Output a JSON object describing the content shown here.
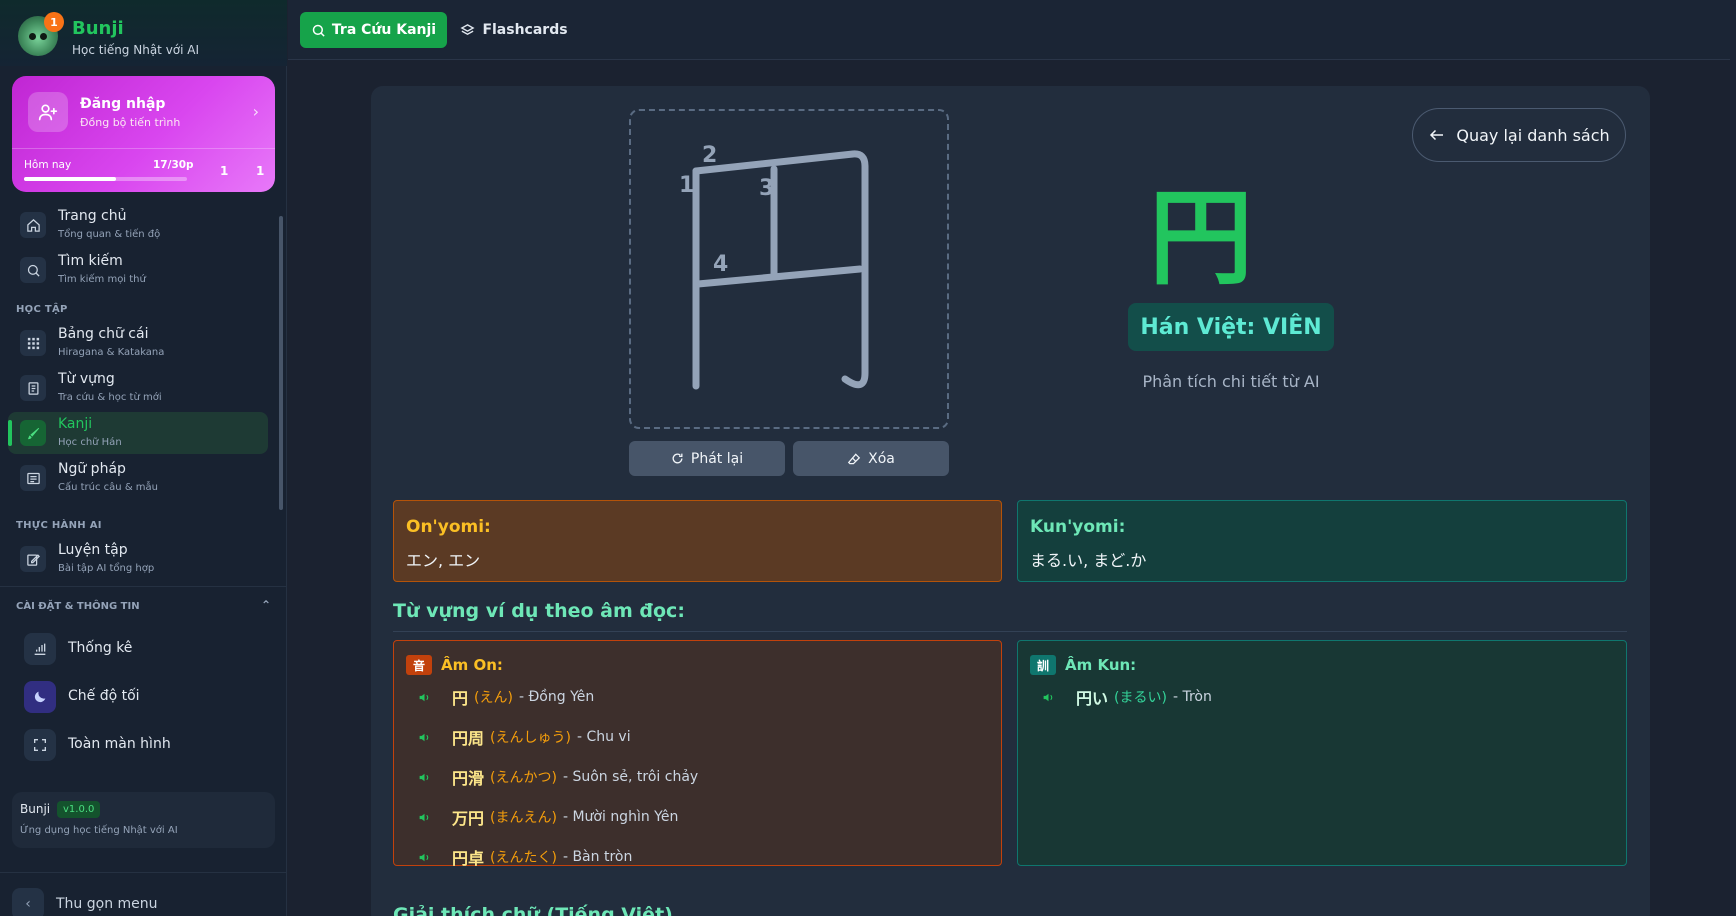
{
  "brand": {
    "name": "Bunji",
    "subtitle": "Học tiếng Nhật với AI",
    "badge": "1"
  },
  "login": {
    "title": "Đăng nhập",
    "subtitle": "Đồng bộ tiến trình",
    "today_label": "Hôm nay",
    "today_value": "17/30p",
    "progress_fraction": 0.567,
    "stat1": "1",
    "stat2": "1"
  },
  "nav": {
    "items": [
      {
        "title": "Trang chủ",
        "sub": "Tổng quan & tiến độ",
        "icon": "home-icon"
      },
      {
        "title": "Tìm kiếm",
        "sub": "Tìm kiếm mọi thứ",
        "icon": "search-icon"
      },
      {
        "title": "Bảng chữ cái",
        "sub": "Hiragana & Katakana",
        "icon": "grid-icon"
      },
      {
        "title": "Từ vựng",
        "sub": "Tra cứu & học từ mới",
        "icon": "book-icon"
      },
      {
        "title": "Kanji",
        "sub": "Học chữ Hán",
        "icon": "brush-icon",
        "active": true
      },
      {
        "title": "Ngữ pháp",
        "sub": "Cấu trúc câu & mẫu",
        "icon": "list-icon"
      },
      {
        "title": "Luyện tập",
        "sub": "Bài tập AI tổng hợp",
        "icon": "edit-icon"
      }
    ],
    "section_learning": "HỌC TẬP",
    "section_ai": "THỰC HÀNH AI"
  },
  "settings": {
    "heading": "CÀI ĐẶT & THÔNG TIN",
    "items": [
      {
        "label": "Thống kê",
        "icon": "chart-icon"
      },
      {
        "label": "Chế độ tối",
        "icon": "moon-icon"
      },
      {
        "label": "Toàn màn hình",
        "icon": "fullscreen-icon"
      }
    ]
  },
  "version": {
    "name": "Bunji",
    "badge": "v1.0.0",
    "subtitle": "Ứng dụng học tiếng Nhật với AI"
  },
  "collapse_label": "Thu gọn menu",
  "topbar": {
    "primary_tab": "Tra Cứu Kanji",
    "secondary_tab": "Flashcards"
  },
  "kanji": {
    "character": "円",
    "han_viet": "Hán Việt: VIÊN",
    "analysis": "Phân tích chi tiết từ AI",
    "stroke_numbers": [
      "1",
      "2",
      "3",
      "4"
    ],
    "replay_label": "Phát lại",
    "clear_label": "Xóa",
    "back_label": "Quay lại danh sách"
  },
  "readings": {
    "on_title": "On'yomi:",
    "on_value": "エン, エン",
    "kun_title": "Kun'yomi:",
    "kun_value": "まる.い, まど.か"
  },
  "examples": {
    "heading": "Từ vựng ví dụ theo âm đọc:",
    "on_badge": "音",
    "on_title": "Âm On:",
    "on_items": [
      {
        "word": "円",
        "reading": "(えん)",
        "meaning": "- Đồng Yên"
      },
      {
        "word": "円周",
        "reading": "(えんしゅう)",
        "meaning": "- Chu vi"
      },
      {
        "word": "円滑",
        "reading": "(えんかつ)",
        "meaning": "- Suôn sẻ, trôi chảy"
      },
      {
        "word": "万円",
        "reading": "(まんえん)",
        "meaning": "- Mười nghìn Yên"
      },
      {
        "word": "円卓",
        "reading": "(えんたく)",
        "meaning": "- Bàn tròn"
      }
    ],
    "kun_badge": "訓",
    "kun_title": "Âm Kun:",
    "kun_items": [
      {
        "word": "円い",
        "reading": "(まるい)",
        "meaning": "- Tròn"
      }
    ]
  },
  "next_section": "Giải thích chữ (Tiếng Việt)"
}
